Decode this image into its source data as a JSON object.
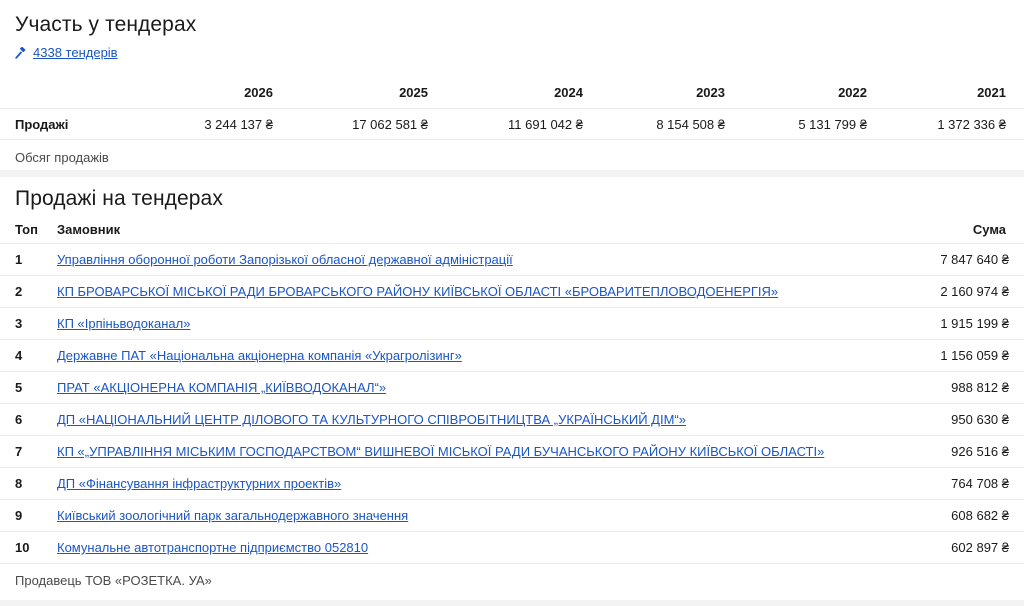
{
  "participation": {
    "title": "Участь у тендерах",
    "tender_count_link": "4338 тендерів",
    "icon": "hammer-icon",
    "years": [
      "2026",
      "2025",
      "2024",
      "2023",
      "2022",
      "2021"
    ],
    "sales_label": "Продажі",
    "sales_values": [
      "3 244 137 ₴",
      "17 062 581 ₴",
      "11 691 042 ₴",
      "8 154 508 ₴",
      "5 131 799 ₴",
      "1 372 336 ₴"
    ],
    "caption": "Обсяг продажів"
  },
  "tender_sales": {
    "title": "Продажі на тендерах",
    "columns": {
      "rank": "Топ",
      "customer": "Замовник",
      "amount": "Сума"
    },
    "rows": [
      {
        "rank": "1",
        "customer": "Управління оборонної роботи Запорізької обласної державної адміністрації",
        "amount": "7 847 640 ₴"
      },
      {
        "rank": "2",
        "customer": "КП БРОВАРСЬКОЇ МІСЬКОЇ РАДИ БРОВАРСЬКОГО РАЙОНУ КИЇВСЬКОЇ ОБЛАСТІ «БРОВАРИТЕПЛОВОДОЕНЕРГІЯ»",
        "amount": "2 160 974 ₴"
      },
      {
        "rank": "3",
        "customer": "КП «Ірпіньводоканал»",
        "amount": "1 915 199 ₴"
      },
      {
        "rank": "4",
        "customer": "Державне ПАТ «Національна акціонерна компанія «Украгролізинг»",
        "amount": "1 156 059 ₴"
      },
      {
        "rank": "5",
        "customer": "ПРАТ «АКЦІОНЕРНА КОМПАНІЯ „КИЇВВОДОКАНАЛ“»",
        "amount": "988 812 ₴"
      },
      {
        "rank": "6",
        "customer": "ДП «НАЦІОНАЛЬНИЙ ЦЕНТР ДІЛОВОГО ТА КУЛЬТУРНОГО СПІВРОБІТНИЦТВА „УКРАЇНСЬКИЙ ДІМ“»",
        "amount": "950 630 ₴"
      },
      {
        "rank": "7",
        "customer": "КП «„УПРАВЛІННЯ МІСЬКИМ ГОСПОДАРСТВОМ“ ВИШНЕВОЇ МІСЬКОЇ РАДИ БУЧАНСЬКОГО РАЙОНУ КИЇВСЬКОЇ ОБЛАСТІ»",
        "amount": "926 516 ₴"
      },
      {
        "rank": "8",
        "customer": "ДП «Фінансування інфраструктурних проектів»",
        "amount": "764 708 ₴"
      },
      {
        "rank": "9",
        "customer": "Київський зоологічний парк загальнодержавного значення",
        "amount": "608 682 ₴"
      },
      {
        "rank": "10",
        "customer": "Комунальне автотранспортне підприємство 052810",
        "amount": "602 897 ₴"
      }
    ],
    "caption": "Продавець ТОВ «РОЗЕТКА. УА»"
  }
}
